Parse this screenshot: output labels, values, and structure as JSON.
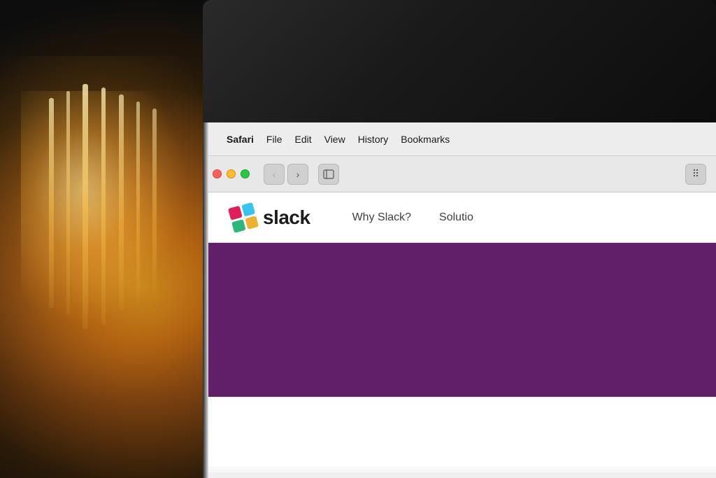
{
  "background": {
    "description": "Warm bokeh background with light bulb"
  },
  "menubar": {
    "apple_label": "",
    "safari_label": "Safari",
    "file_label": "File",
    "edit_label": "Edit",
    "view_label": "View",
    "history_label": "History",
    "bookmarks_label": "Bookmarks"
  },
  "toolbar": {
    "back_label": "‹",
    "forward_label": "›",
    "grid_label": "⋯"
  },
  "traffic_lights": {
    "red": "#ff5f57",
    "yellow": "#febc2e",
    "green": "#28c840"
  },
  "slack": {
    "logo_text": "slack",
    "nav_item1": "Why Slack?",
    "nav_item2": "Solutio",
    "hero_color": "#611f69",
    "icon_colors": {
      "top_left": "#e01e5a",
      "top_right": "#36c5f0",
      "bottom_left": "#2eb67d",
      "bottom_right": "#ecb22e"
    }
  }
}
